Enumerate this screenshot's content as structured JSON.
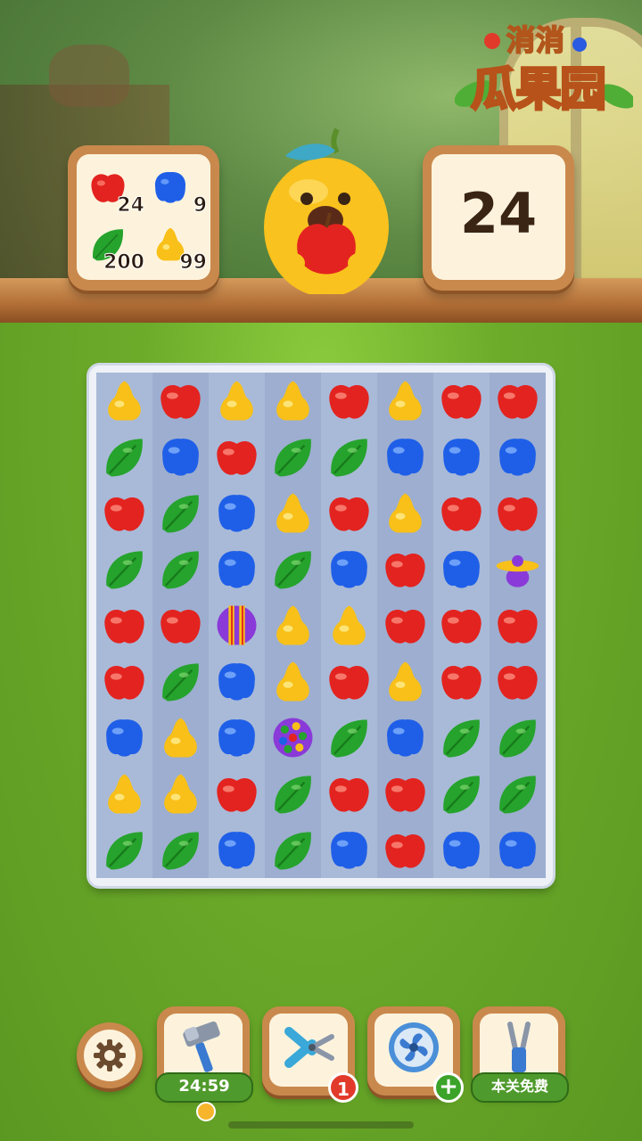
{
  "logo": {
    "line1": "消消",
    "line2": "瓜果园"
  },
  "goals": [
    {
      "fruit": "apple",
      "count": "24"
    },
    {
      "fruit": "plum",
      "count": "9"
    },
    {
      "fruit": "leaf",
      "count": "200"
    },
    {
      "fruit": "pear",
      "count": "99"
    }
  ],
  "moves_left": "24",
  "board": {
    "rows": [
      [
        "pear",
        "apple",
        "pear",
        "pear",
        "apple",
        "pear",
        "apple",
        "apple"
      ],
      [
        "leaf",
        "plum",
        "apple",
        "leaf",
        "leaf",
        "plum",
        "plum",
        "plum"
      ],
      [
        "apple",
        "leaf",
        "plum",
        "pear",
        "apple",
        "pear",
        "apple",
        "apple"
      ],
      [
        "leaf",
        "leaf",
        "plum",
        "leaf",
        "plum",
        "apple",
        "plum",
        "propeller"
      ],
      [
        "apple",
        "apple",
        "striped-ball",
        "pear",
        "pear",
        "apple",
        "apple",
        "apple"
      ],
      [
        "apple",
        "leaf",
        "plum",
        "pear",
        "apple",
        "pear",
        "apple",
        "apple"
      ],
      [
        "plum",
        "pear",
        "plum",
        "rainbow-ball",
        "leaf",
        "plum",
        "leaf",
        "leaf"
      ],
      [
        "pear",
        "pear",
        "apple",
        "leaf",
        "apple",
        "apple",
        "leaf",
        "leaf"
      ],
      [
        "leaf",
        "leaf",
        "plum",
        "leaf",
        "plum",
        "apple",
        "plum",
        "plum"
      ]
    ]
  },
  "toolbar": {
    "settings_icon": "gear-icon",
    "hammer_timer": "24:59",
    "scissors_count": "1",
    "fan_plus": "+",
    "free_label": "本关免费"
  },
  "colors": {
    "apple": "#e3231f",
    "plum": "#1f5fe8",
    "leaf": "#25a32c",
    "pear": "#f8c018",
    "wood": "#c9894d",
    "board_bg": "#a9bad8"
  }
}
